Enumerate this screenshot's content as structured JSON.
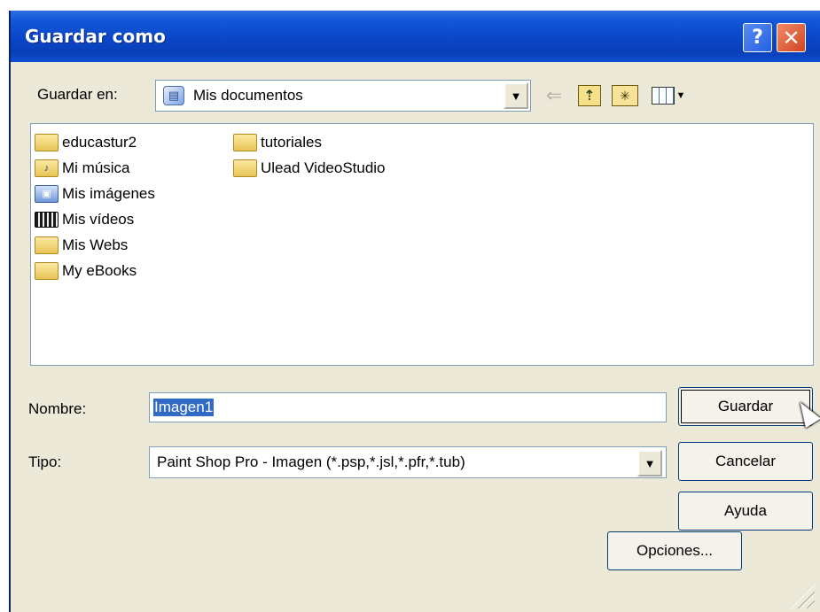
{
  "window": {
    "title": "Guardar como",
    "help_glyph": "?",
    "close_glyph": "✕"
  },
  "look_in": {
    "label": "Guardar en:",
    "value": "Mis documentos",
    "icon": "my-documents-icon"
  },
  "toolbar": {
    "icons": [
      "back-arrow-icon",
      "up-folder-icon",
      "new-folder-icon",
      "view-menu-icon"
    ]
  },
  "files": {
    "column1": [
      {
        "name": "educastur2",
        "icon": "folder-icon"
      },
      {
        "name": "Mi música",
        "icon": "music-folder-icon"
      },
      {
        "name": "Mis imágenes",
        "icon": "pictures-folder-icon"
      },
      {
        "name": "Mis vídeos",
        "icon": "videos-folder-icon"
      },
      {
        "name": "Mis Webs",
        "icon": "folder-icon"
      },
      {
        "name": "My eBooks",
        "icon": "folder-icon"
      }
    ],
    "column2": [
      {
        "name": "tutoriales",
        "icon": "folder-icon"
      },
      {
        "name": "Ulead VideoStudio",
        "icon": "folder-icon"
      }
    ]
  },
  "form": {
    "name_label": "Nombre:",
    "name_value": "Imagen1",
    "type_label": "Tipo:",
    "type_value": "Paint Shop Pro - Imagen (*.psp,*.jsl,*.pfr,*.tub)"
  },
  "buttons": {
    "save": "Guardar",
    "cancel": "Cancelar",
    "help": "Ayuda",
    "options": "Opciones..."
  },
  "colors": {
    "titlebar": "#0a46c8",
    "dialog_bg": "#ece9d8",
    "selection": "#316ac5"
  }
}
